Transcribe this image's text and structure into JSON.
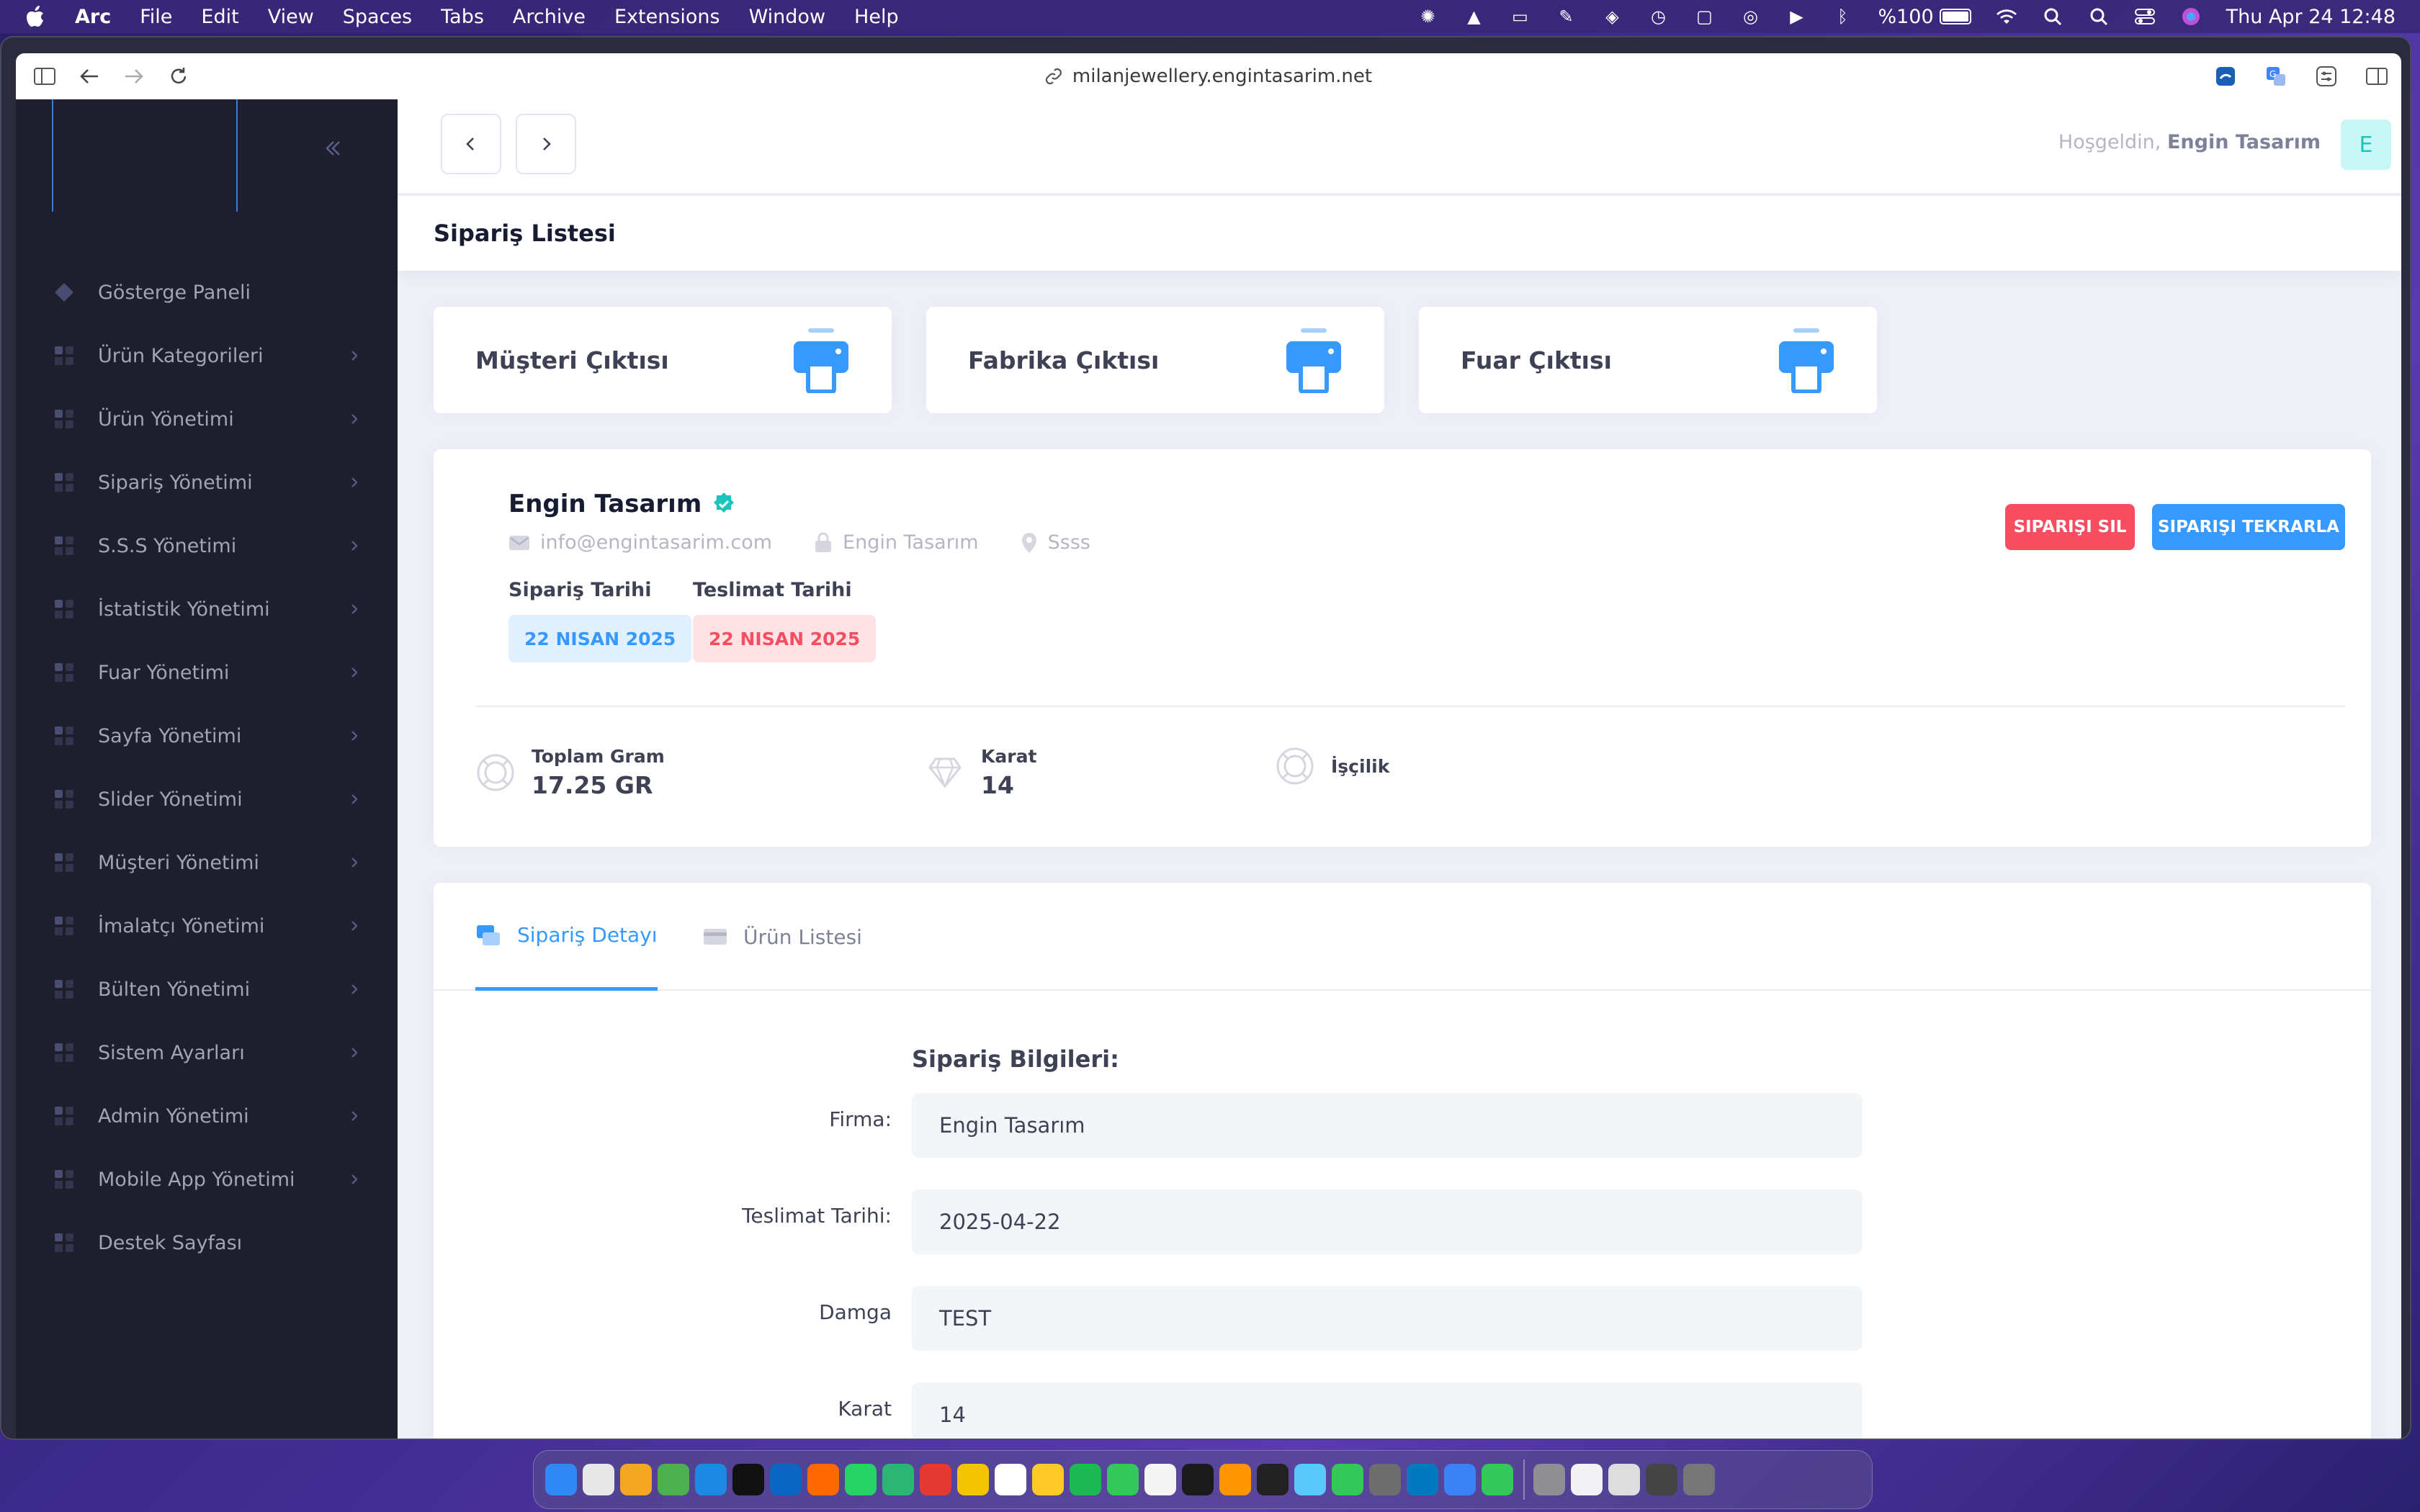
{
  "menubar": {
    "app_name": "Arc",
    "menus": [
      "File",
      "Edit",
      "View",
      "Spaces",
      "Tabs",
      "Archive",
      "Extensions",
      "Window",
      "Help"
    ],
    "battery": "%100",
    "datetime": "Thu Apr 24  12:48"
  },
  "browser": {
    "url": "milanjewellery.engintasarim.net"
  },
  "sidebar": {
    "items": [
      {
        "label": "Gösterge Paneli",
        "icon": "diamond-icon",
        "has_arrow": false
      },
      {
        "label": "Ürün Kategorileri",
        "icon": "grid-icon",
        "has_arrow": true
      },
      {
        "label": "Ürün Yönetimi",
        "icon": "grid-icon",
        "has_arrow": true
      },
      {
        "label": "Sipariş Yönetimi",
        "icon": "grid-icon",
        "has_arrow": true
      },
      {
        "label": "S.S.S Yönetimi",
        "icon": "grid-icon",
        "has_arrow": true
      },
      {
        "label": "İstatistik Yönetimi",
        "icon": "grid-icon",
        "has_arrow": true
      },
      {
        "label": "Fuar Yönetimi",
        "icon": "grid-icon",
        "has_arrow": true
      },
      {
        "label": "Sayfa Yönetimi",
        "icon": "grid-icon",
        "has_arrow": true
      },
      {
        "label": "Slider Yönetimi",
        "icon": "grid-icon",
        "has_arrow": true
      },
      {
        "label": "Müşteri Yönetimi",
        "icon": "grid-icon",
        "has_arrow": true
      },
      {
        "label": "İmalatçı Yönetimi",
        "icon": "grid-icon",
        "has_arrow": true
      },
      {
        "label": "Bülten Yönetimi",
        "icon": "grid-icon",
        "has_arrow": true
      },
      {
        "label": "Sistem Ayarları",
        "icon": "grid-icon",
        "has_arrow": true
      },
      {
        "label": "Admin Yönetimi",
        "icon": "grid-icon",
        "has_arrow": true
      },
      {
        "label": "Mobile App Yönetimi",
        "icon": "grid-icon",
        "has_arrow": true
      },
      {
        "label": "Destek Sayfası",
        "icon": "grid-icon",
        "has_arrow": false
      }
    ]
  },
  "header": {
    "greeting_prefix": "Hoşgeldin,",
    "user_name": "Engin Tasarım",
    "avatar_letter": "E"
  },
  "page": {
    "title": "Sipariş Listesi"
  },
  "print_cards": [
    {
      "label": "Müşteri Çıktısı"
    },
    {
      "label": "Fabrika Çıktısı"
    },
    {
      "label": "Fuar Çıktısı"
    }
  ],
  "customer": {
    "name": "Engin Tasarım",
    "email": "info@engintasarim.com",
    "company": "Engin Tasarım",
    "location": "Ssss",
    "order_date_label": "Sipariş Tarihi",
    "order_date": "22 NISAN 2025",
    "delivery_date_label": "Teslimat Tarihi",
    "delivery_date": "22 NISAN 2025",
    "delete_label": "SIPARIŞI SIL",
    "repeat_label": "SIPARIŞI TEKRARLA",
    "stats": {
      "total_gram_label": "Toplam Gram",
      "total_gram_value": "17.25 GR",
      "karat_label": "Karat",
      "karat_value": "14",
      "labor_label": "İşçilik"
    }
  },
  "detail": {
    "tabs": [
      {
        "label": "Sipariş Detayı",
        "active": true
      },
      {
        "label": "Ürün Listesi",
        "active": false
      }
    ],
    "section_title": "Sipariş Bilgileri:",
    "fields": [
      {
        "label": "Firma:",
        "value": "Engin Tasarım"
      },
      {
        "label": "Teslimat Tarihi:",
        "value": "2025-04-22"
      },
      {
        "label": "Damga",
        "value": "TEST"
      },
      {
        "label": "Karat",
        "value": "14"
      }
    ]
  },
  "colors": {
    "primary": "#3699ff",
    "danger": "#f64e60",
    "sidebar_bg": "#1e1e2d",
    "success_teal": "#1bc5bd"
  }
}
